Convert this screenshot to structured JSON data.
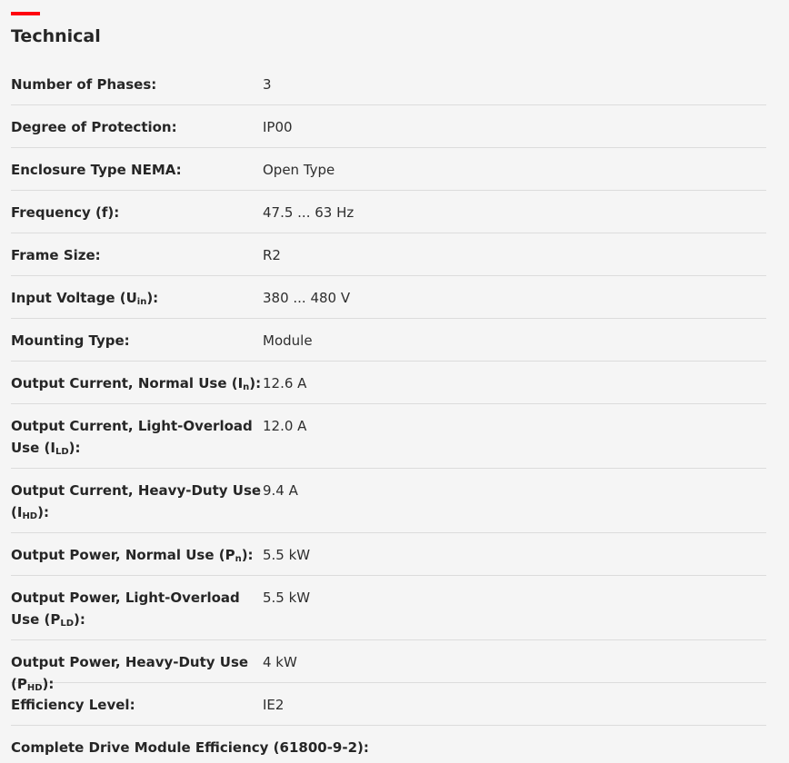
{
  "section": {
    "title": "Technical",
    "accent_color": "#ff000f"
  },
  "rows": [
    {
      "label": "Number of Phases:",
      "value": "3"
    },
    {
      "label": "Degree of Protection:",
      "value": "IP00"
    },
    {
      "label": "Enclosure Type NEMA:",
      "value": "Open Type"
    },
    {
      "label": "Frequency (f):",
      "value": "47.5 ... 63 Hz"
    },
    {
      "label": "Frame Size:",
      "value": "R2"
    },
    {
      "label_main": "Input Voltage (U",
      "label_sub": "in",
      "label_close": "):",
      "value": "380 ... 480 V"
    },
    {
      "label": "Mounting Type:",
      "value": "Module"
    },
    {
      "label_main": "Output Current, Normal Use (I",
      "label_sub": "n",
      "label_close": "):",
      "value": "12.6 A"
    },
    {
      "label_main": "Output Current, Light-Overload Use (I",
      "label_sub": "LD",
      "label_close": "):",
      "value": "12.0 A"
    },
    {
      "label_main": "Output Current, Heavy-Duty Use (I",
      "label_sub": "HD",
      "label_close": "):",
      "value": "9.4 A"
    },
    {
      "label_main": "Output Power, Normal Use (P",
      "label_sub": "n",
      "label_close": "):",
      "value": "5.5 kW"
    },
    {
      "label_main": "Output Power, Light-Overload Use (P",
      "label_sub": "LD",
      "label_close": "):",
      "value": "5.5 kW"
    },
    {
      "label_main": "Output Power, Heavy-Duty Use (P",
      "label_sub": "HD",
      "label_close": "):",
      "value": "4 kW"
    },
    {
      "label": "Efficiency Level:",
      "value": "IE2"
    },
    {
      "label": "Complete Drive Module Efficiency (61800-9-2):",
      "value": ""
    }
  ]
}
